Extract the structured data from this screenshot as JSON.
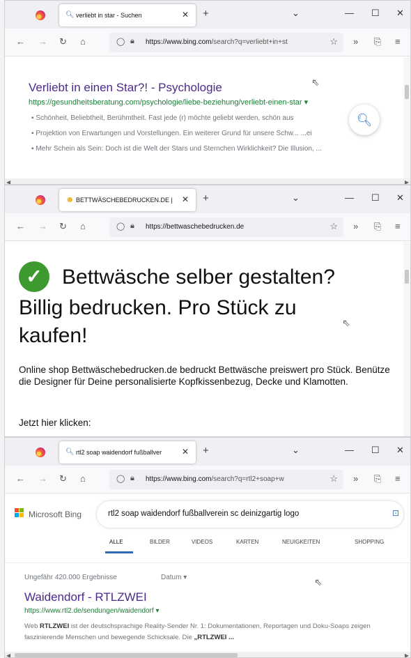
{
  "windows": [
    {
      "tab": {
        "favicon": "search-icon",
        "title": "verliebt in star - Suchen"
      },
      "url": {
        "host": "https://www.bing.com",
        "path": "/search?q=verliebt+in+st"
      },
      "result": {
        "title": "Verliebt in einen Star?! - Psychologie",
        "url": "https://gesundheitsberatung.com/psychologie/liebe-beziehung/verliebt-einen-star ▾",
        "bullets": [
          "Schönheit, Beliebtheit, Berühmtheit. Fast jede (r) möchte geliebt werden, schön aus",
          "Projektion von Erwartungen und Vorstellungen. Ein weiterer Grund für unsere Schw... ...ei",
          "Mehr Schein als Sein: Doch ist die Welt der Stars und Sternchen Wirklichkeit? Die Illusion, ..."
        ]
      }
    },
    {
      "tab": {
        "favicon": "smiley-icon",
        "title": "BETTWÄSCHEBEDRUCKEN.DE |"
      },
      "url": {
        "host": "https://bettwaschebedrucken.de",
        "path": ""
      },
      "page": {
        "heading_line1": "Bettwäsche selber gestalten?",
        "heading_line2": "Billig bedrucken. Pro Stück zu",
        "heading_line3": "kaufen!",
        "body": "Online shop Bettwäschebedrucken.de bedruckt Bettwäsche preiswert pro Stück. Benütze die Designer für Deine personalisierte Kopfkissenbezug, Decke und Klamotten.",
        "cta": "Jetzt hier klicken:"
      }
    },
    {
      "tab": {
        "favicon": "search-icon",
        "title": "rtl2 soap waidendorf fußballver"
      },
      "url": {
        "host": "https://www.bing.com",
        "path": "/search?q=rtl2+soap+w"
      },
      "bing": {
        "brand": "Microsoft Bing",
        "query": "rtl2 soap waidendorf fußballverein sc deinizgartig logo",
        "tabs": [
          "ALLE",
          "BILDER",
          "VIDEOS",
          "KARTEN",
          "NEUIGKEITEN",
          "SHOPPING"
        ],
        "count": "Ungefähr 420.000 Ergebnisse",
        "date_filter": "Datum ▾",
        "result_title": "Waidendorf - RTLZWEI",
        "result_url": "https://www.rtl2.de/sendungen/waidendorf ▾",
        "snippet_prefix": "Web",
        "snippet_brand": "RTLZWEI",
        "snippet_text": " ist der deutschsprachige Reality-Sender Nr. 1: Dokumentationen, Reportagen und Doku-Soaps zeigen faszinierende Menschen und bewegende Schicksale. Die",
        "snippet_end": " „RTLZWEI ..."
      }
    }
  ],
  "colors": {
    "link": "#4c2a8c",
    "url_green": "#1a7f37",
    "check_green": "#3d9a2f",
    "bing_blue": "#2d6db5"
  }
}
